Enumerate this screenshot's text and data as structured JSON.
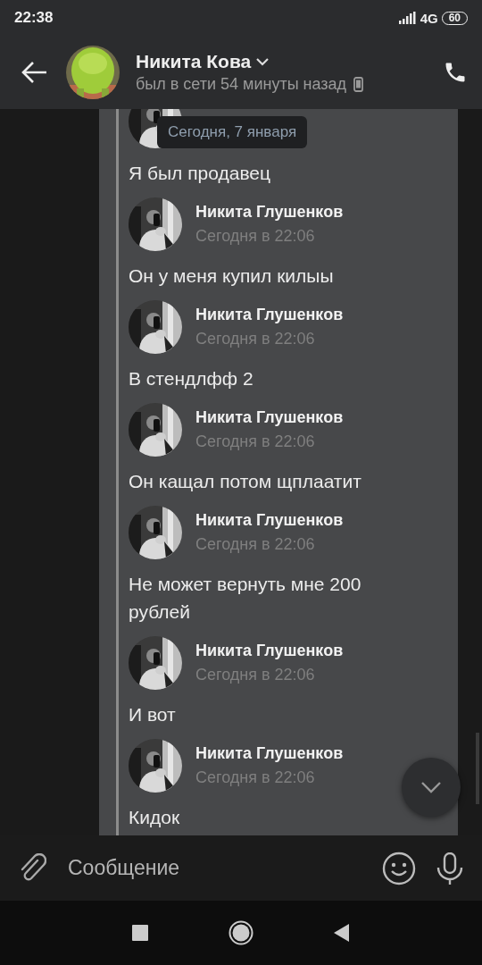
{
  "status_bar": {
    "time": "22:38",
    "network": "4G",
    "battery": "60"
  },
  "header": {
    "name": "Никита Кова",
    "status": "был в сети 54 минуты назад"
  },
  "date_chip": "Сегодня, 7 января",
  "messages": [
    {
      "text": "Я был продавец"
    },
    {
      "name": "Никита Глушенков",
      "time": "Сегодня в 22:06",
      "text": "Он у меня купил килыы"
    },
    {
      "name": "Никита Глушенков",
      "time": "Сегодня в 22:06",
      "text": "В стендлфф 2"
    },
    {
      "name": "Никита Глушенков",
      "time": "Сегодня в 22:06",
      "text": "Он кащал потом щплаатит"
    },
    {
      "name": "Никита Глушенков",
      "time": "Сегодня в 22:06",
      "text": "Не может вернуть мне 200 рублей"
    },
    {
      "name": "Никита Глушенков",
      "time": "Сегодня в 22:06",
      "text": "И вот"
    },
    {
      "name": "Никита Глушенков",
      "time": "Сегодня в 22:06",
      "text": "Кидок"
    }
  ],
  "composer": {
    "placeholder": "Сообщение"
  }
}
